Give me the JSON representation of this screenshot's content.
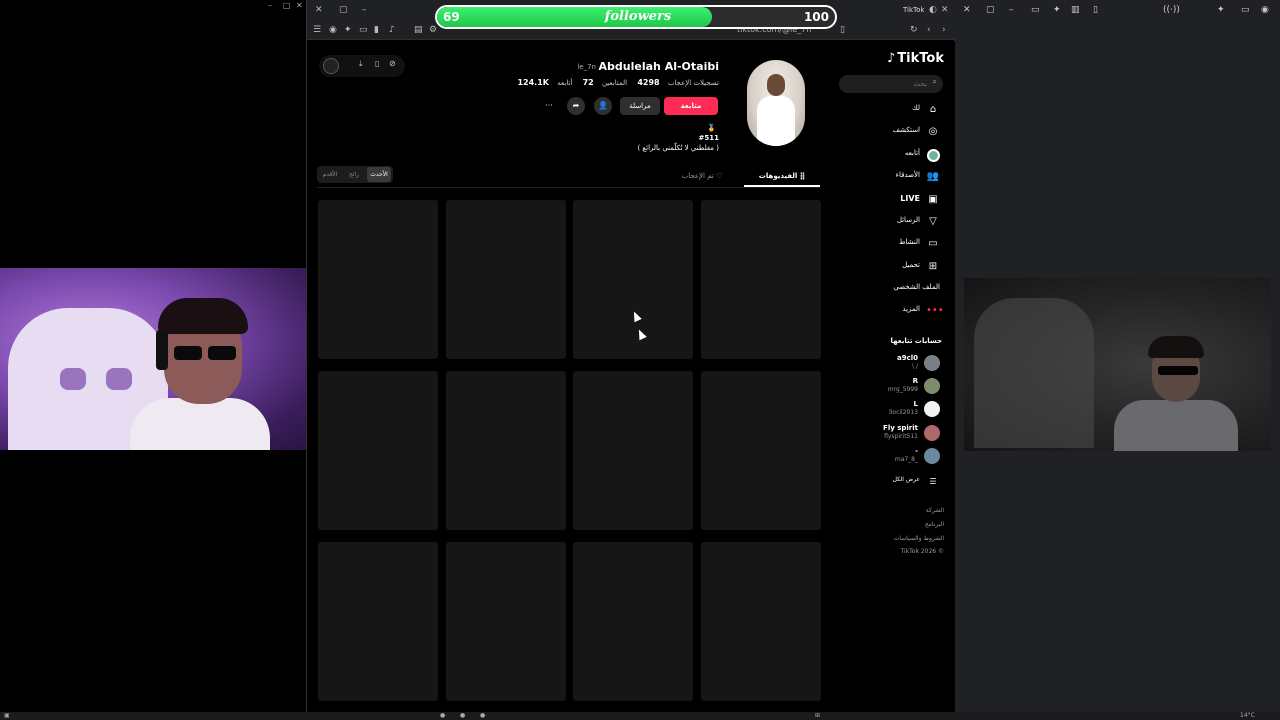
{
  "stream_overlay": {
    "followers_current": "69",
    "followers_label": "followers",
    "followers_goal": "100",
    "progress_fraction": 0.69
  },
  "browser": {
    "url": "tiktok.com/@le_7n",
    "tab_title": "TikTok"
  },
  "tiktok": {
    "logo": "TikTok",
    "search_placeholder": "بحث",
    "nav": [
      {
        "label": "لك",
        "icon": "home-icon"
      },
      {
        "label": "استكشف",
        "icon": "compass-icon"
      },
      {
        "label": "أتابعه",
        "icon": "following-avatar-icon"
      },
      {
        "label": "الأصدقاء",
        "icon": "friends-icon"
      },
      {
        "label": "LIVE",
        "icon": "live-icon"
      },
      {
        "label": "الرسائل",
        "icon": "messages-icon"
      },
      {
        "label": "النشاط",
        "icon": "activity-icon"
      },
      {
        "label": "تحميل",
        "icon": "upload-icon"
      },
      {
        "label": "الملف الشخصي",
        "icon": "profile-icon"
      },
      {
        "label": "المزيد",
        "icon": "more-icon"
      }
    ],
    "following_title": "حسابات تتابعها",
    "following_accounts": [
      {
        "name": "a9cl0",
        "handle": "\\ /",
        "color": "#7a8088"
      },
      {
        "name": "R",
        "handle": "mrg_5999",
        "color": "#7d8c6a"
      },
      {
        "name": "L",
        "handle": "llocil2013",
        "color": "#f2f2f2"
      },
      {
        "name": "Fly spirit",
        "handle": "flyspirit511",
        "color": "#b0686a"
      },
      {
        "name": "-",
        "handle": "ma7_8_",
        "color": "#6b8aa0"
      }
    ],
    "see_all": "عرض الكل",
    "footer": [
      "الشركة",
      "البرنامج",
      "الشروط والسياسات",
      "TikTok 2026 ©"
    ],
    "profile": {
      "display_name": "Abdulelah Al-Otaibi",
      "username": "le_7n",
      "following_count": "72",
      "following_label": "أتابعه",
      "followers_count": "4298",
      "followers_label": "المتابعين",
      "likes_count": "124.1K",
      "likes_label": "تسجيلات الإعجاب",
      "follow_button": "متابعة",
      "message_button": "مراسلة",
      "bio_tag": "#511",
      "bio_text": "( مغلطني لا تُكلّمني بالرائع )"
    },
    "tabs": {
      "videos": "الفيديوهات",
      "liked": "تم الإعجاب"
    },
    "sort": [
      "الأحدث",
      "رائج",
      "الأقدم"
    ]
  },
  "taskbar": {
    "temperature": "14°C"
  }
}
